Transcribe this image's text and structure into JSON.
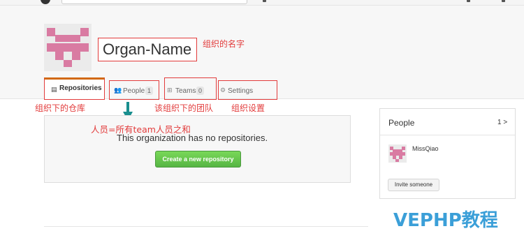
{
  "org": {
    "name": "Organ-Name"
  },
  "tabs": [
    {
      "label": "Repositories",
      "icon": "repo-icon"
    },
    {
      "label": "People",
      "count": "1",
      "icon": "people-icon"
    },
    {
      "label": "Teams",
      "count": "0",
      "icon": "teams-icon"
    },
    {
      "label": "Settings",
      "icon": "gear-icon"
    }
  ],
  "annotations": {
    "org_name": "组织的名字",
    "repos": "组织下的仓库",
    "teams": "该组织下的团队",
    "settings": "组织设置",
    "people": "人员=所有team人员之和"
  },
  "main": {
    "empty_message": "This organization has no repositories.",
    "create_button": "Create a new repository"
  },
  "sidebar": {
    "title": "People",
    "count": "1 >",
    "member_name": "MissQiao",
    "invite_button": "Invite someone"
  },
  "watermark": "VEPHP教程",
  "colors": {
    "annotation": "#e23b3b",
    "avatar_pink": "#d97ba2",
    "button_green": "#56b544",
    "active_tab_accent": "#d26911",
    "arrow": "#1a8f8f",
    "watermark": "#3b9fd8"
  }
}
